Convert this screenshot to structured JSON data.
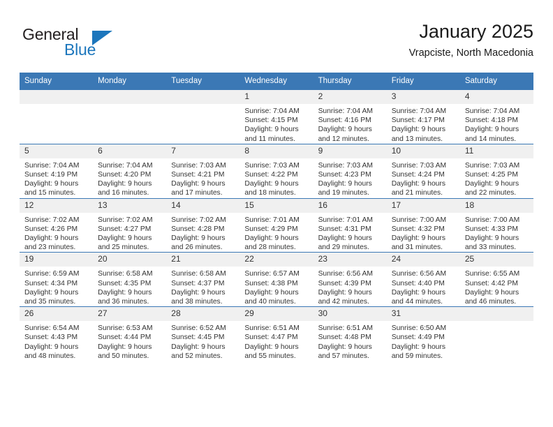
{
  "logo": {
    "word1": "General",
    "word2": "Blue",
    "triangle_color": "#1c76bc",
    "icon": "triangle-icon"
  },
  "header": {
    "title": "January 2025",
    "subtitle": "Vrapciste, North Macedonia",
    "header_bg": "#3b78b5",
    "daynum_bg": "#f0f0f0"
  },
  "weekdays": [
    "Sunday",
    "Monday",
    "Tuesday",
    "Wednesday",
    "Thursday",
    "Friday",
    "Saturday"
  ],
  "labels": {
    "sunrise": "Sunrise:",
    "sunset": "Sunset:",
    "daylight": "Daylight:"
  },
  "weeks": [
    [
      {
        "day": "",
        "empty": true
      },
      {
        "day": "",
        "empty": true
      },
      {
        "day": "",
        "empty": true
      },
      {
        "day": "1",
        "sunrise": "Sunrise: 7:04 AM",
        "sunset": "Sunset: 4:15 PM",
        "daylight1": "Daylight: 9 hours",
        "daylight2": "and 11 minutes."
      },
      {
        "day": "2",
        "sunrise": "Sunrise: 7:04 AM",
        "sunset": "Sunset: 4:16 PM",
        "daylight1": "Daylight: 9 hours",
        "daylight2": "and 12 minutes."
      },
      {
        "day": "3",
        "sunrise": "Sunrise: 7:04 AM",
        "sunset": "Sunset: 4:17 PM",
        "daylight1": "Daylight: 9 hours",
        "daylight2": "and 13 minutes."
      },
      {
        "day": "4",
        "sunrise": "Sunrise: 7:04 AM",
        "sunset": "Sunset: 4:18 PM",
        "daylight1": "Daylight: 9 hours",
        "daylight2": "and 14 minutes."
      }
    ],
    [
      {
        "day": "5",
        "sunrise": "Sunrise: 7:04 AM",
        "sunset": "Sunset: 4:19 PM",
        "daylight1": "Daylight: 9 hours",
        "daylight2": "and 15 minutes."
      },
      {
        "day": "6",
        "sunrise": "Sunrise: 7:04 AM",
        "sunset": "Sunset: 4:20 PM",
        "daylight1": "Daylight: 9 hours",
        "daylight2": "and 16 minutes."
      },
      {
        "day": "7",
        "sunrise": "Sunrise: 7:03 AM",
        "sunset": "Sunset: 4:21 PM",
        "daylight1": "Daylight: 9 hours",
        "daylight2": "and 17 minutes."
      },
      {
        "day": "8",
        "sunrise": "Sunrise: 7:03 AM",
        "sunset": "Sunset: 4:22 PM",
        "daylight1": "Daylight: 9 hours",
        "daylight2": "and 18 minutes."
      },
      {
        "day": "9",
        "sunrise": "Sunrise: 7:03 AM",
        "sunset": "Sunset: 4:23 PM",
        "daylight1": "Daylight: 9 hours",
        "daylight2": "and 19 minutes."
      },
      {
        "day": "10",
        "sunrise": "Sunrise: 7:03 AM",
        "sunset": "Sunset: 4:24 PM",
        "daylight1": "Daylight: 9 hours",
        "daylight2": "and 21 minutes."
      },
      {
        "day": "11",
        "sunrise": "Sunrise: 7:03 AM",
        "sunset": "Sunset: 4:25 PM",
        "daylight1": "Daylight: 9 hours",
        "daylight2": "and 22 minutes."
      }
    ],
    [
      {
        "day": "12",
        "sunrise": "Sunrise: 7:02 AM",
        "sunset": "Sunset: 4:26 PM",
        "daylight1": "Daylight: 9 hours",
        "daylight2": "and 23 minutes."
      },
      {
        "day": "13",
        "sunrise": "Sunrise: 7:02 AM",
        "sunset": "Sunset: 4:27 PM",
        "daylight1": "Daylight: 9 hours",
        "daylight2": "and 25 minutes."
      },
      {
        "day": "14",
        "sunrise": "Sunrise: 7:02 AM",
        "sunset": "Sunset: 4:28 PM",
        "daylight1": "Daylight: 9 hours",
        "daylight2": "and 26 minutes."
      },
      {
        "day": "15",
        "sunrise": "Sunrise: 7:01 AM",
        "sunset": "Sunset: 4:29 PM",
        "daylight1": "Daylight: 9 hours",
        "daylight2": "and 28 minutes."
      },
      {
        "day": "16",
        "sunrise": "Sunrise: 7:01 AM",
        "sunset": "Sunset: 4:31 PM",
        "daylight1": "Daylight: 9 hours",
        "daylight2": "and 29 minutes."
      },
      {
        "day": "17",
        "sunrise": "Sunrise: 7:00 AM",
        "sunset": "Sunset: 4:32 PM",
        "daylight1": "Daylight: 9 hours",
        "daylight2": "and 31 minutes."
      },
      {
        "day": "18",
        "sunrise": "Sunrise: 7:00 AM",
        "sunset": "Sunset: 4:33 PM",
        "daylight1": "Daylight: 9 hours",
        "daylight2": "and 33 minutes."
      }
    ],
    [
      {
        "day": "19",
        "sunrise": "Sunrise: 6:59 AM",
        "sunset": "Sunset: 4:34 PM",
        "daylight1": "Daylight: 9 hours",
        "daylight2": "and 35 minutes."
      },
      {
        "day": "20",
        "sunrise": "Sunrise: 6:58 AM",
        "sunset": "Sunset: 4:35 PM",
        "daylight1": "Daylight: 9 hours",
        "daylight2": "and 36 minutes."
      },
      {
        "day": "21",
        "sunrise": "Sunrise: 6:58 AM",
        "sunset": "Sunset: 4:37 PM",
        "daylight1": "Daylight: 9 hours",
        "daylight2": "and 38 minutes."
      },
      {
        "day": "22",
        "sunrise": "Sunrise: 6:57 AM",
        "sunset": "Sunset: 4:38 PM",
        "daylight1": "Daylight: 9 hours",
        "daylight2": "and 40 minutes."
      },
      {
        "day": "23",
        "sunrise": "Sunrise: 6:56 AM",
        "sunset": "Sunset: 4:39 PM",
        "daylight1": "Daylight: 9 hours",
        "daylight2": "and 42 minutes."
      },
      {
        "day": "24",
        "sunrise": "Sunrise: 6:56 AM",
        "sunset": "Sunset: 4:40 PM",
        "daylight1": "Daylight: 9 hours",
        "daylight2": "and 44 minutes."
      },
      {
        "day": "25",
        "sunrise": "Sunrise: 6:55 AM",
        "sunset": "Sunset: 4:42 PM",
        "daylight1": "Daylight: 9 hours",
        "daylight2": "and 46 minutes."
      }
    ],
    [
      {
        "day": "26",
        "sunrise": "Sunrise: 6:54 AM",
        "sunset": "Sunset: 4:43 PM",
        "daylight1": "Daylight: 9 hours",
        "daylight2": "and 48 minutes."
      },
      {
        "day": "27",
        "sunrise": "Sunrise: 6:53 AM",
        "sunset": "Sunset: 4:44 PM",
        "daylight1": "Daylight: 9 hours",
        "daylight2": "and 50 minutes."
      },
      {
        "day": "28",
        "sunrise": "Sunrise: 6:52 AM",
        "sunset": "Sunset: 4:45 PM",
        "daylight1": "Daylight: 9 hours",
        "daylight2": "and 52 minutes."
      },
      {
        "day": "29",
        "sunrise": "Sunrise: 6:51 AM",
        "sunset": "Sunset: 4:47 PM",
        "daylight1": "Daylight: 9 hours",
        "daylight2": "and 55 minutes."
      },
      {
        "day": "30",
        "sunrise": "Sunrise: 6:51 AM",
        "sunset": "Sunset: 4:48 PM",
        "daylight1": "Daylight: 9 hours",
        "daylight2": "and 57 minutes."
      },
      {
        "day": "31",
        "sunrise": "Sunrise: 6:50 AM",
        "sunset": "Sunset: 4:49 PM",
        "daylight1": "Daylight: 9 hours",
        "daylight2": "and 59 minutes."
      },
      {
        "day": "",
        "empty": true
      }
    ]
  ]
}
